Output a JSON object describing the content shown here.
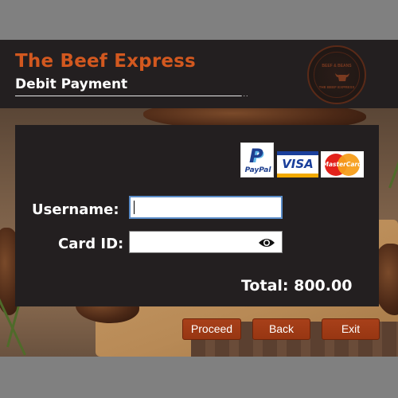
{
  "header": {
    "title": "The Beef Express",
    "subtitle": "Debit Payment",
    "rule_suffix": "...",
    "logo": {
      "top_text": "BEEF & BEANS",
      "bottom_text": "THE BEEF EXPRESS",
      "icon": "bull-logo-icon"
    }
  },
  "payment_methods": {
    "paypal": "PayPal",
    "visa": "VISA",
    "mastercard": "MasterCard"
  },
  "form": {
    "username_label": "Username:",
    "username_value": "",
    "card_label": "Card ID:",
    "card_value": "",
    "show_password_icon": "eye-icon"
  },
  "total": "Total: 800.00",
  "buttons": {
    "proceed": "Proceed",
    "back": "Back",
    "exit": "Exit"
  },
  "colors": {
    "accent": "#d2581f",
    "button": "#a8401a",
    "panel": "#231f20",
    "page_bg": "#808080"
  }
}
